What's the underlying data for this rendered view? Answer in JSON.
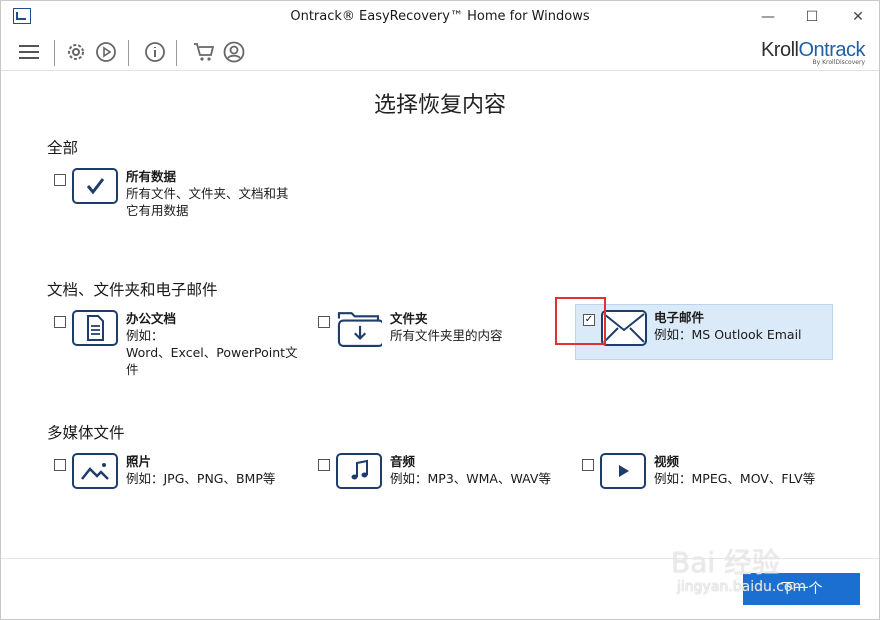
{
  "window": {
    "title": "Ontrack® EasyRecovery™ Home for Windows",
    "minimize": "—",
    "maximize": "☐",
    "close": "✕"
  },
  "brand": {
    "name_part1": "Kroll",
    "name_part2": "Ontrack",
    "tagline": "By KrollDiscovery"
  },
  "page": {
    "title": "选择恢复内容"
  },
  "sections": {
    "all": {
      "title": "全部",
      "items": [
        {
          "title": "所有数据",
          "line1": "所有文件、文件夹、文档和其",
          "line2": "它有用数据",
          "checked": false
        }
      ]
    },
    "docs": {
      "title": "文档、文件夹和电子邮件",
      "items": [
        {
          "title": "办公文档",
          "line1": "例如：",
          "line2": "Word、Excel、PowerPoint文件",
          "checked": false
        },
        {
          "title": "文件夹",
          "line1": "所有文件夹里的内容",
          "checked": false
        },
        {
          "title": "电子邮件",
          "line1": "例如：MS Outlook Email",
          "checked": true
        }
      ]
    },
    "media": {
      "title": "多媒体文件",
      "items": [
        {
          "title": "照片",
          "line1": "例如：JPG、PNG、BMP等",
          "checked": false
        },
        {
          "title": "音频",
          "line1": "例如：MP3、WMA、WAV等",
          "checked": false
        },
        {
          "title": "视频",
          "line1": "例如：MPEG、MOV、FLV等",
          "checked": false
        }
      ]
    }
  },
  "footer": {
    "next_label": "下一个"
  },
  "watermark": {
    "main": "Bai 经验",
    "sub": "jingyan.baidu.com"
  },
  "colors": {
    "accent": "#1a6fd1",
    "icon_stroke": "#1f3d6b",
    "selected_bg": "#dbeaf8",
    "highlight": "#e03030"
  }
}
